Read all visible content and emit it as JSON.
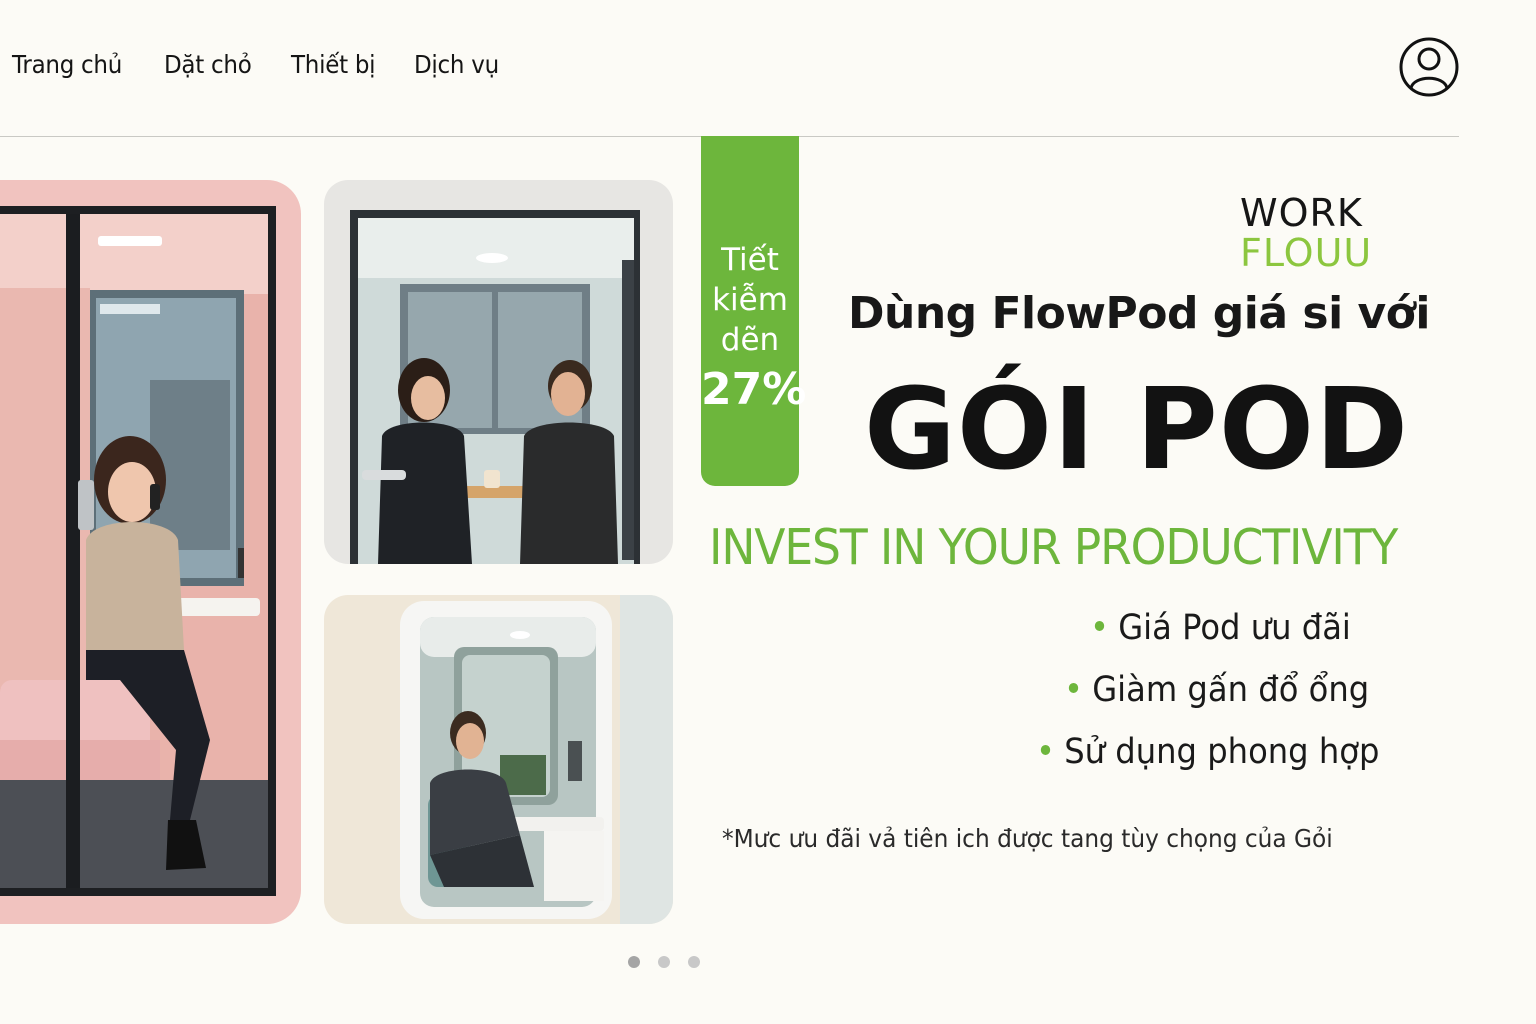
{
  "nav": {
    "items": [
      "Trang chủ",
      "Dặt chỏ",
      "Thiết bị",
      "Dịch vụ"
    ]
  },
  "account": {
    "icon": "user-icon"
  },
  "badge": {
    "words": [
      "Tiết",
      "kiễm",
      "dẽn"
    ],
    "percent": "27%"
  },
  "logo": {
    "line1": "WORK",
    "line2": "FLOUU"
  },
  "hero": {
    "subheading": "Dùng FlowPod giá si với",
    "heading": "GÓI POD",
    "tagline": "INVEST IN YOUR PRODUCTIVITY",
    "benefits": [
      "Giá Pod ưu đãi",
      "Giàm gấn đổ ổng",
      "Sử dụng phong hợp"
    ],
    "note": "*Mưc ưu đãi vả tiên ich được tang tùy chọng của Gỏi"
  },
  "carousel": {
    "count": 3,
    "active_index": 0
  },
  "colors": {
    "accent_green": "#6db63c",
    "logo_green": "#8cc63f",
    "background": "#fcfbf6",
    "pod_pink": "#f2c7c3"
  }
}
